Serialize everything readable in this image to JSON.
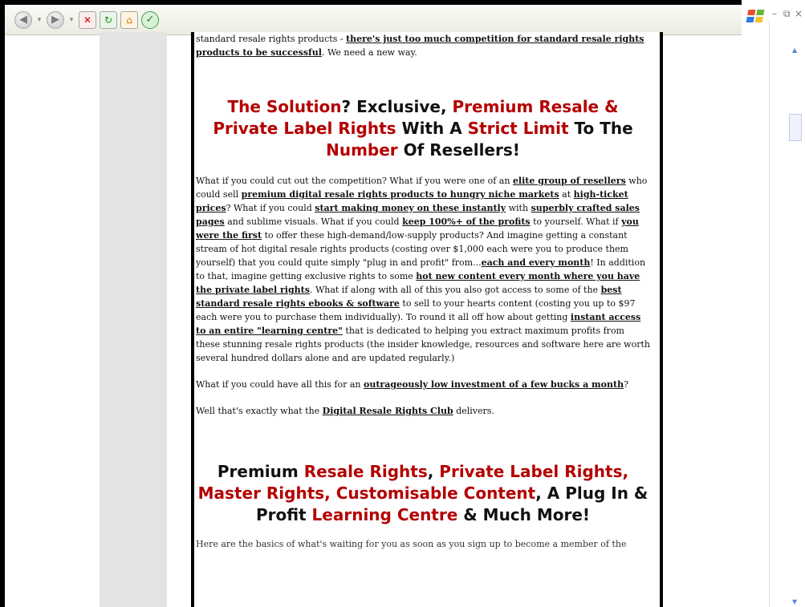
{
  "browser": {
    "toolbar_icons": [
      "back-icon",
      "forward-icon",
      "stop-icon",
      "refresh-icon",
      "home-icon",
      "media-icon"
    ],
    "window_controls": [
      "–",
      "⧉",
      "×"
    ]
  },
  "page": {
    "intro": {
      "line_start": "standard resale rights products - ",
      "line_bold": "there's just too much competition for standard resale rights products to be successful",
      "line_end": ". We need a new way."
    },
    "headline1": {
      "p1": "The Solution",
      "p2": "? Exclusive, ",
      "p3": "Premium Resale & Private Label Rights",
      "p4": " With A ",
      "p5": "Strict Limit",
      "p6": " To The ",
      "p7": "Number",
      "p8": " Of Resellers!"
    },
    "body": {
      "t01": "What if you could cut out the competition? What if you were one of an ",
      "b01": "elite group of resellers",
      "t02": " who could sell ",
      "b02": "premium digital resale rights products to hungry niche markets",
      "t03": " at ",
      "b03": "high-ticket prices",
      "t04": "? What if you could ",
      "b04": "start making money on these instantly",
      "t05": " with ",
      "b05": "superbly crafted sales pages",
      "t06": " and sublime visuals. What if you could ",
      "b06": "keep 100%+ of the profits",
      "t07": " to yourself. What if ",
      "b07": "you were the first",
      "t08": " to offer these high-demand/low-supply products? And imagine getting a constant stream of hot digital resale rights products (costing over $1,000 each were you to produce them yourself) that you could quite simply \"plug in and profit\" from...",
      "b08": "each and every month",
      "t09": "! In addition to that, imagine getting exclusive rights to some ",
      "b09": "hot new content every month where you have the private label rights",
      "t10": ". What if along with all of this you also got access to some of the ",
      "b10": "best standard resale rights ebooks & software",
      "t11": " to sell to your hearts content (costing you up to $97 each were you to purchase them individually). To round it all off how about getting ",
      "b11": "instant access to an entire \"learning centre\"",
      "t12": " that is dedicated to helping you extract maximum profits from these stunning resale rights products (the insider knowledge, resources and software here are worth several hundred dollars alone and are updated regularly.)"
    },
    "para2": {
      "t1": "What if you could have all this for an ",
      "b1": "outrageously low investment of a few bucks a month",
      "t2": "?"
    },
    "para3": {
      "t1": "Well that's exactly what the ",
      "b1": "Digital Resale Rights Club",
      "t2": " delivers."
    },
    "headline2": {
      "p1": "Premium ",
      "p2": "Resale Rights",
      "p3": ", ",
      "p4": "Private Label Rights, Master Rights, Customisable Content",
      "p5": ", A Plug In & Profit ",
      "p6": "Learning Centre",
      "p7": " & Much More!"
    },
    "cutoff": "Here are the basics of what's waiting for you as soon as you sign up to become a member of the"
  },
  "colors": {
    "headline_red": "#b40000",
    "gutter_gray": "#e3e3e3"
  }
}
